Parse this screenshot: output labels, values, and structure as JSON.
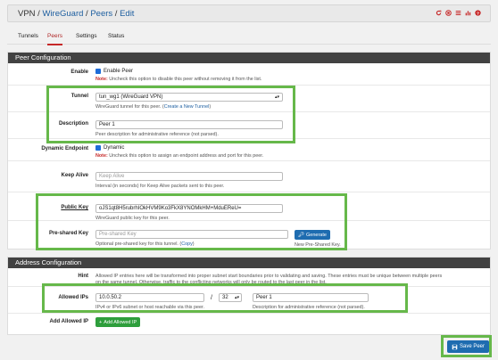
{
  "breadcrumb": {
    "vpn": "VPN",
    "sep1": " / ",
    "wireguard": "WireGuard",
    "sep2": " / ",
    "peers": "Peers",
    "sep3": " / ",
    "edit": "Edit"
  },
  "header_icons": [
    "restart-icon",
    "stop-icon",
    "menu-icon",
    "chart-icon",
    "help-icon"
  ],
  "tabs": [
    {
      "label": "Tunnels"
    },
    {
      "label": "Peers"
    },
    {
      "label": "Settings"
    },
    {
      "label": "Status"
    }
  ],
  "peer_config": {
    "title": "Peer Configuration",
    "enable": {
      "label": "Enable",
      "checkbox": "Enable Peer",
      "note_prefix": "Note:",
      "note": " Uncheck this option to disable this peer without removing it from the list."
    },
    "tunnel": {
      "label": "Tunnel",
      "value": "tun_wg1 (WireGuard VPN)",
      "note": "WireGuard tunnel for this peer. (",
      "link": "Create a New Tunnel",
      "note_end": ")"
    },
    "description": {
      "label": "Description",
      "value": "Peer 1",
      "note": "Peer description for administrative reference (not parsed)."
    },
    "dynamic": {
      "label": "Dynamic Endpoint",
      "checkbox": "Dynamic",
      "note_prefix": "Note:",
      "note": " Uncheck this option to assign an endpoint address and port for this peer."
    },
    "keepalive": {
      "label": "Keep Alive",
      "placeholder": "Keep Alive",
      "note": "Interval (in seconds) for Keep Alive packets sent to this peer."
    },
    "public_key": {
      "label": "Public Key",
      "value": "oJS1qt8H5rubrhIOkHVM9Ko3FkX8YNOMkHM+MduEReU=",
      "note": "WireGuard public key for this peer."
    },
    "psk": {
      "label": "Pre-shared Key",
      "placeholder": "Pre-shared Key",
      "note": "Optional pre-shared key for this tunnel. (",
      "link": "Copy",
      "note_end": ")",
      "button": "Generate",
      "button_note": "New Pre-Shared Key."
    }
  },
  "address_config": {
    "title": "Address Configuration",
    "hint": {
      "label": "Hint",
      "text1": "Allowed IP entries here will be transformed into proper subnet start boundaries prior to validating and saving. These entries must be unique between multiple peers",
      "text2": "on the same tunnel. Otherwise, traffic to the conflicting networks will only be routed to the last peer in the list."
    },
    "allowed_ips": {
      "label": "Allowed IPs",
      "ip": "10.0.50.2",
      "slash": "/",
      "mask": "32",
      "desc": "Peer 1",
      "ip_note": "IPv4 or IPv6 subnet or host reachable via this peer.",
      "desc_note": "Description for administrative reference (not parsed)."
    },
    "add": {
      "label": "Add Allowed IP",
      "button": "Add Allowed IP",
      "button_icon": "+"
    }
  },
  "save": {
    "label": "Save Peer"
  }
}
